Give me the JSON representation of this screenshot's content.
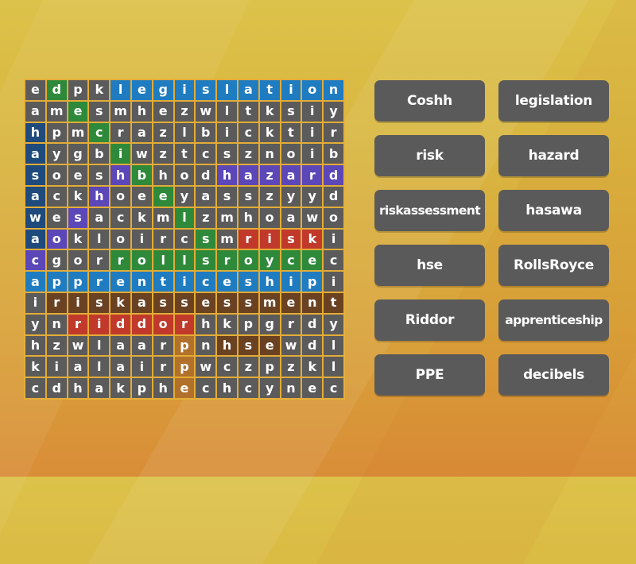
{
  "puzzle": {
    "grid": [
      [
        "e",
        "d",
        "p",
        "k",
        "l",
        "e",
        "g",
        "i",
        "s",
        "l",
        "a",
        "t",
        "i",
        "o",
        "n"
      ],
      [
        "a",
        "m",
        "e",
        "s",
        "m",
        "h",
        "e",
        "z",
        "w",
        "l",
        "t",
        "k",
        "s",
        "i",
        "y"
      ],
      [
        "h",
        "p",
        "m",
        "c",
        "r",
        "a",
        "z",
        "l",
        "b",
        "i",
        "c",
        "k",
        "t",
        "i",
        "r"
      ],
      [
        "a",
        "y",
        "g",
        "b",
        "i",
        "w",
        "z",
        "t",
        "c",
        "s",
        "z",
        "n",
        "o",
        "i",
        "b"
      ],
      [
        "s",
        "o",
        "e",
        "s",
        "h",
        "b",
        "h",
        "o",
        "d",
        "h",
        "a",
        "z",
        "a",
        "r",
        "d"
      ],
      [
        "a",
        "c",
        "k",
        "h",
        "o",
        "e",
        "e",
        "y",
        "a",
        "s",
        "s",
        "z",
        "y",
        "y",
        "d"
      ],
      [
        "w",
        "e",
        "s",
        "a",
        "c",
        "k",
        "m",
        "l",
        "z",
        "m",
        "h",
        "o",
        "a",
        "w",
        "o"
      ],
      [
        "a",
        "o",
        "k",
        "l",
        "o",
        "i",
        "r",
        "c",
        "s",
        "m",
        "r",
        "i",
        "s",
        "k",
        "i"
      ],
      [
        "c",
        "g",
        "o",
        "r",
        "r",
        "o",
        "l",
        "l",
        "s",
        "r",
        "o",
        "y",
        "c",
        "e",
        "c"
      ],
      [
        "a",
        "p",
        "p",
        "r",
        "e",
        "n",
        "t",
        "i",
        "c",
        "e",
        "s",
        "h",
        "i",
        "p",
        "i"
      ],
      [
        "i",
        "r",
        "i",
        "s",
        "k",
        "a",
        "s",
        "s",
        "e",
        "s",
        "s",
        "m",
        "e",
        "n",
        "t"
      ],
      [
        "y",
        "n",
        "r",
        "i",
        "d",
        "d",
        "o",
        "r",
        "h",
        "k",
        "p",
        "g",
        "r",
        "d",
        "y"
      ],
      [
        "h",
        "z",
        "w",
        "l",
        "a",
        "a",
        "r",
        "p",
        "n",
        "h",
        "s",
        "e",
        "w",
        "d",
        "l"
      ],
      [
        "k",
        "i",
        "a",
        "l",
        "a",
        "i",
        "r",
        "p",
        "w",
        "c",
        "z",
        "p",
        "z",
        "k",
        "l"
      ],
      [
        "c",
        "d",
        "h",
        "a",
        "k",
        "p",
        "h",
        "e",
        "c",
        "h",
        "c",
        "y",
        "n",
        "e",
        "c"
      ]
    ],
    "found_words": [
      {
        "word": "legislation",
        "color": "#1f7cc1",
        "cells": [
          [
            0,
            4
          ],
          [
            0,
            5
          ],
          [
            0,
            6
          ],
          [
            0,
            7
          ],
          [
            0,
            8
          ],
          [
            0,
            9
          ],
          [
            0,
            10
          ],
          [
            0,
            11
          ],
          [
            0,
            12
          ],
          [
            0,
            13
          ],
          [
            0,
            14
          ]
        ]
      },
      {
        "word": "decibels",
        "color": "#2e8a3a",
        "cells": [
          [
            0,
            1
          ],
          [
            1,
            2
          ],
          [
            2,
            3
          ],
          [
            3,
            4
          ],
          [
            4,
            5
          ],
          [
            5,
            6
          ],
          [
            6,
            7
          ],
          [
            7,
            8
          ]
        ]
      },
      {
        "word": "hasawa",
        "color": "#1f4a7c",
        "cells": [
          [
            2,
            0
          ],
          [
            3,
            0
          ],
          [
            4,
            0
          ],
          [
            5,
            0
          ],
          [
            6,
            0
          ],
          [
            7,
            0
          ]
        ]
      },
      {
        "word": "hazard",
        "color": "#5b47b8",
        "cells": [
          [
            4,
            9
          ],
          [
            4,
            10
          ],
          [
            4,
            11
          ],
          [
            4,
            12
          ],
          [
            4,
            13
          ],
          [
            4,
            14
          ]
        ]
      },
      {
        "word": "Coshh",
        "color": "#5b47b8",
        "cells": [
          [
            8,
            0
          ],
          [
            7,
            1
          ],
          [
            6,
            2
          ],
          [
            5,
            3
          ],
          [
            4,
            4
          ]
        ]
      },
      {
        "word": "risk",
        "color": "#c0392b",
        "cells": [
          [
            7,
            10
          ],
          [
            7,
            11
          ],
          [
            7,
            12
          ],
          [
            7,
            13
          ]
        ]
      },
      {
        "word": "RollsRoyce",
        "color": "#2e8a3a",
        "cells": [
          [
            8,
            4
          ],
          [
            8,
            5
          ],
          [
            8,
            6
          ],
          [
            8,
            7
          ],
          [
            8,
            8
          ],
          [
            8,
            9
          ],
          [
            8,
            10
          ],
          [
            8,
            11
          ],
          [
            8,
            12
          ],
          [
            8,
            13
          ]
        ]
      },
      {
        "word": "apprenticeship",
        "color": "#1f7cc1",
        "cells": [
          [
            9,
            0
          ],
          [
            9,
            1
          ],
          [
            9,
            2
          ],
          [
            9,
            3
          ],
          [
            9,
            4
          ],
          [
            9,
            5
          ],
          [
            9,
            6
          ],
          [
            9,
            7
          ],
          [
            9,
            8
          ],
          [
            9,
            9
          ],
          [
            9,
            10
          ],
          [
            9,
            11
          ],
          [
            9,
            12
          ],
          [
            9,
            13
          ]
        ]
      },
      {
        "word": "riskassessment",
        "color": "#6a4222",
        "cells": [
          [
            10,
            1
          ],
          [
            10,
            2
          ],
          [
            10,
            3
          ],
          [
            10,
            4
          ],
          [
            10,
            5
          ],
          [
            10,
            6
          ],
          [
            10,
            7
          ],
          [
            10,
            8
          ],
          [
            10,
            9
          ],
          [
            10,
            10
          ],
          [
            10,
            11
          ],
          [
            10,
            12
          ],
          [
            10,
            13
          ],
          [
            10,
            14
          ]
        ]
      },
      {
        "word": "Riddor",
        "color": "#c0392b",
        "cells": [
          [
            11,
            2
          ],
          [
            11,
            3
          ],
          [
            11,
            4
          ],
          [
            11,
            5
          ],
          [
            11,
            6
          ],
          [
            11,
            7
          ]
        ]
      },
      {
        "word": "hse",
        "color": "#6a4222",
        "cells": [
          [
            12,
            9
          ],
          [
            12,
            10
          ],
          [
            12,
            11
          ]
        ]
      },
      {
        "word": "PPE",
        "color": "#b2712a",
        "cells": [
          [
            12,
            7
          ],
          [
            13,
            7
          ],
          [
            14,
            7
          ]
        ]
      }
    ]
  },
  "word_list": [
    {
      "label": "Coshh"
    },
    {
      "label": "legislation"
    },
    {
      "label": "risk"
    },
    {
      "label": "hazard"
    },
    {
      "label": "riskassessment"
    },
    {
      "label": "hasawa"
    },
    {
      "label": "hse"
    },
    {
      "label": "RollsRoyce"
    },
    {
      "label": "Riddor"
    },
    {
      "label": "apprenticeship"
    },
    {
      "label": "PPE"
    },
    {
      "label": "decibels"
    }
  ],
  "colors": {
    "cell_default": "#5b5b5b",
    "grid_line": "#e3ac37",
    "button_bg": "#5a5a5a",
    "text": "#ffffff"
  }
}
